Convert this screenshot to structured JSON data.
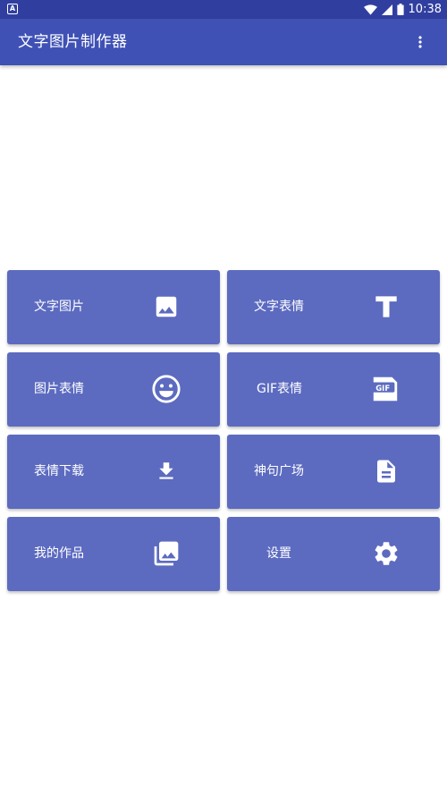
{
  "status_bar": {
    "time": "10:38",
    "notification_icon": "android-notification-icon",
    "wifi_icon": "wifi-icon",
    "signal_icon": "cell-signal-icon",
    "battery_icon": "battery-icon"
  },
  "app_bar": {
    "title": "文字图片制作器",
    "menu_icon": "more-vert-icon",
    "color": "#3f51b5"
  },
  "colors": {
    "status_bar": "#303f9f",
    "tile": "#5c6bc0"
  },
  "grid": [
    {
      "label": "文字图片",
      "icon": "image-icon"
    },
    {
      "label": "文字表情",
      "icon": "text-t-icon"
    },
    {
      "label": "图片表情",
      "icon": "smiley-icon"
    },
    {
      "label": "GIF表情",
      "icon": "gif-icon"
    },
    {
      "label": "表情下载",
      "icon": "download-icon"
    },
    {
      "label": "神句广场",
      "icon": "document-icon"
    },
    {
      "label": "我的作品",
      "icon": "photo-library-icon"
    },
    {
      "label": "设置",
      "icon": "settings-gear-icon"
    }
  ],
  "gif_icon_text": "GIF"
}
